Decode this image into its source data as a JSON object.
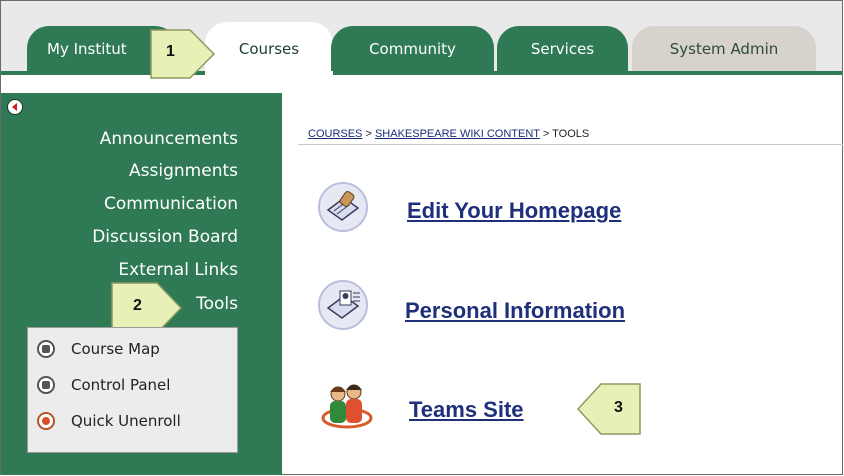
{
  "tabs": [
    {
      "label": "My Institut"
    },
    {
      "label": "Courses"
    },
    {
      "label": "Community"
    },
    {
      "label": "Services"
    },
    {
      "label": "System Admin"
    }
  ],
  "callouts": [
    "1",
    "2",
    "3"
  ],
  "sidebar": {
    "collapse_icon": "arrow-left-circle-icon",
    "items": [
      {
        "label": "Announcements"
      },
      {
        "label": "Assignments"
      },
      {
        "label": "Communication"
      },
      {
        "label": "Discussion Board"
      },
      {
        "label": "External Links"
      },
      {
        "label": "Tools"
      }
    ],
    "submenu": [
      {
        "label": "Course Map",
        "icon": "course-map-icon"
      },
      {
        "label": "Control Panel",
        "icon": "control-panel-icon"
      },
      {
        "label": "Quick Unenroll",
        "icon": "quick-unenroll-icon"
      }
    ]
  },
  "breadcrumb": {
    "root": "COURSES",
    "sep1": ">",
    "course": "SHAKESPEARE WIKI CONTENT",
    "sep2": ">",
    "current": "TOOLS"
  },
  "tools": [
    {
      "label": "Edit Your Homepage",
      "icon": "edit-homepage-icon"
    },
    {
      "label": "Personal Information",
      "icon": "personal-information-icon"
    },
    {
      "label": "Teams Site",
      "icon": "teams-site-icon"
    }
  ],
  "colors": {
    "sidebar": "#2f7a55",
    "callout": "#e8f0b8",
    "link": "#1f2f7a"
  }
}
